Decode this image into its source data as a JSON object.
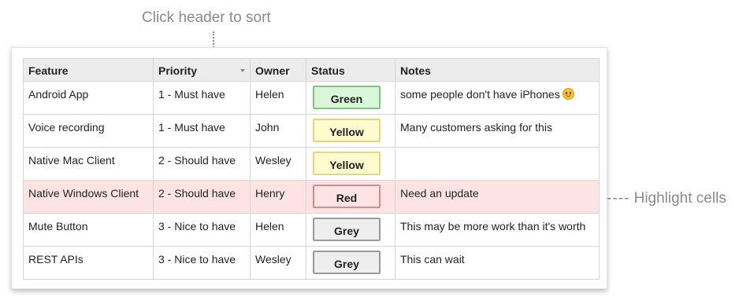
{
  "callouts": {
    "sort_hint": "Click header to sort",
    "highlight_hint": "Highlight cells",
    "highlight_dashes": "----"
  },
  "table": {
    "headers": [
      "Feature",
      "Priority",
      "Owner",
      "Status",
      "Notes"
    ],
    "sorted_column": "Priority",
    "rows": [
      {
        "feature": "Android App",
        "priority": "1 - Must have",
        "owner": "Helen",
        "status": "Green",
        "notes": "some people don't have iPhones",
        "emoji": "smiley-icon",
        "highlighted": false
      },
      {
        "feature": "Voice recording",
        "priority": "1 - Must have",
        "owner": "John",
        "status": "Yellow",
        "notes": "Many customers asking for this",
        "highlighted": false
      },
      {
        "feature": "Native Mac Client",
        "priority": "2 - Should have",
        "owner": "Wesley",
        "status": "Yellow",
        "notes": "",
        "highlighted": false
      },
      {
        "feature": "Native Windows Client",
        "priority": "2 - Should have",
        "owner": "Henry",
        "status": "Red",
        "notes": "Need an update",
        "highlighted": true
      },
      {
        "feature": "Mute Button",
        "priority": "3 - Nice to have",
        "owner": "Helen",
        "status": "Grey",
        "notes": "This may be more work than it's worth",
        "highlighted": false
      },
      {
        "feature": "REST APIs",
        "priority": "3 - Nice to have",
        "owner": "Wesley",
        "status": "Grey",
        "notes": "This can wait",
        "highlighted": false
      }
    ]
  },
  "status_colors": {
    "Green": {
      "bg": "#d9f6d9",
      "border": "#7cc97c"
    },
    "Yellow": {
      "bg": "#fffbcf",
      "border": "#e3d77a"
    },
    "Red": {
      "bg": "#fde3e3",
      "border": "#d98b8b"
    },
    "Grey": {
      "bg": "#eeeeee",
      "border": "#9a9a9a"
    }
  },
  "highlight_color": "#fde3e3"
}
